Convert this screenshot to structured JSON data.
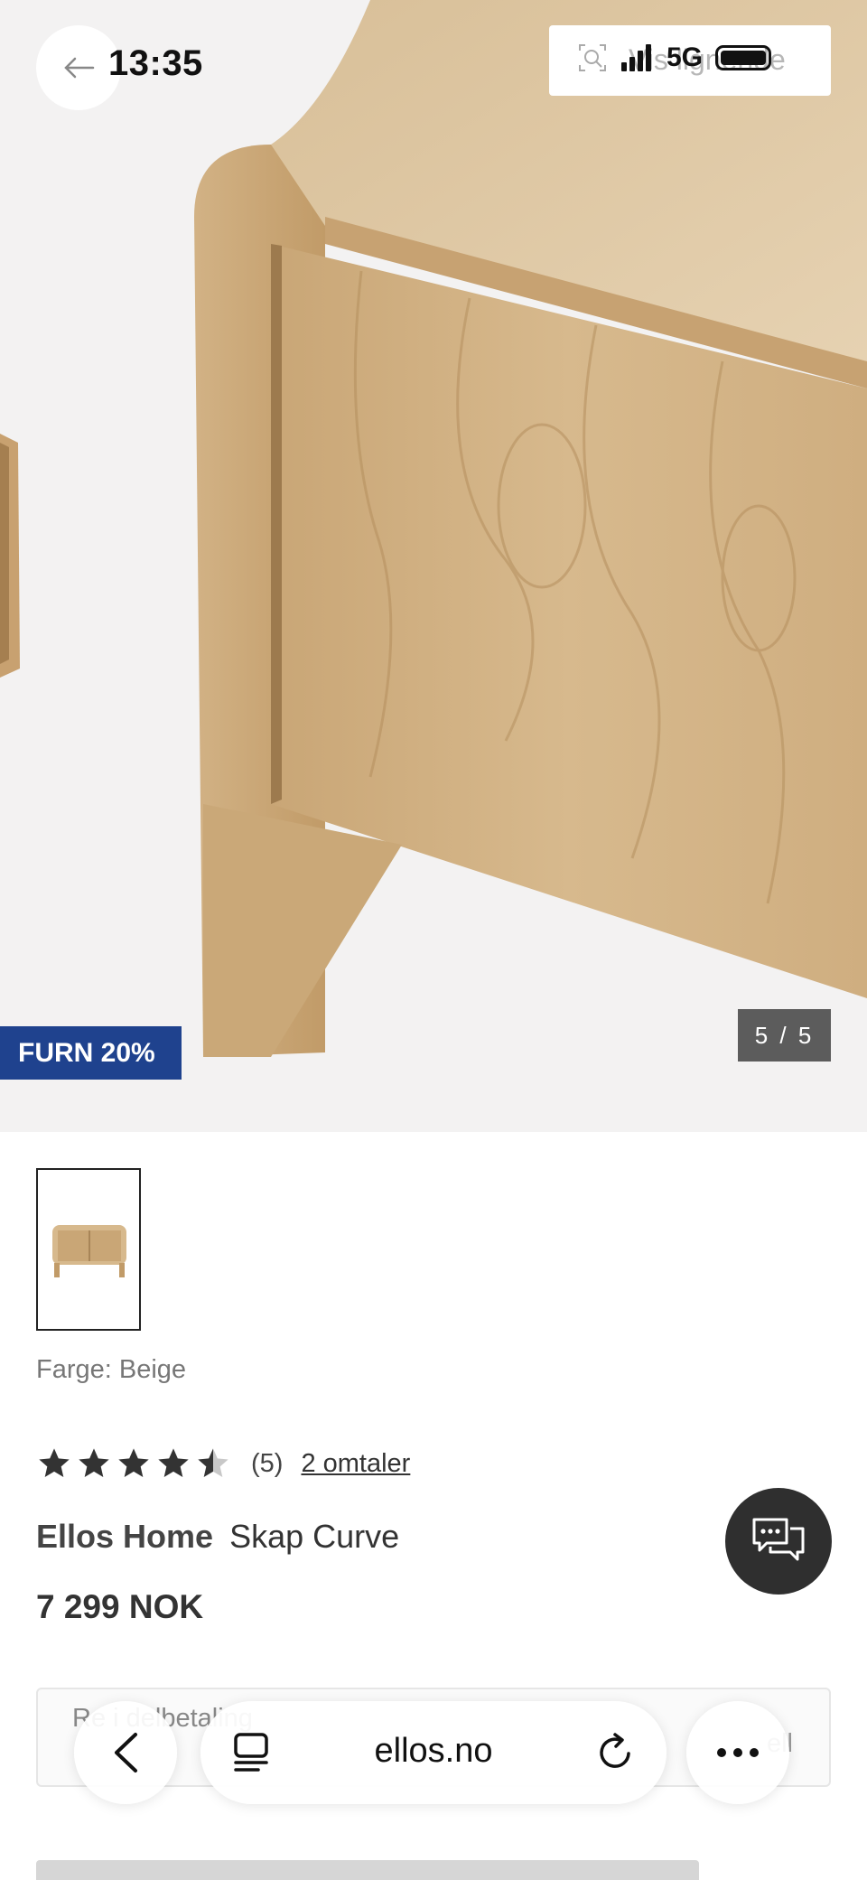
{
  "status_bar": {
    "time": "13:35",
    "network": "5G",
    "overlay_text": "Vis lignende"
  },
  "gallery": {
    "discount_badge": "FURN 20%",
    "counter": "5 / 5"
  },
  "product": {
    "color_label": "Farge: Beige",
    "rating": 4.5,
    "rating_count": "(5)",
    "reviews_link": "2 omtaler",
    "brand": "Ellos Home",
    "name": "Skap Curve",
    "price": "7 299 NOK"
  },
  "payment": {
    "split_text": "Re    i delbetaling",
    "split_right": "ell"
  },
  "browser": {
    "url": "ellos.no"
  },
  "icons": [
    "arrow-left-icon",
    "search-scan-icon",
    "signal-icon",
    "battery-icon",
    "chat-icon",
    "chevron-left-icon",
    "tabs-icon",
    "reload-icon",
    "more-icon",
    "star-icon"
  ],
  "colors": {
    "badge": "#1f428e",
    "counter": "#5c5c5c",
    "chat": "#2f2f2f"
  }
}
